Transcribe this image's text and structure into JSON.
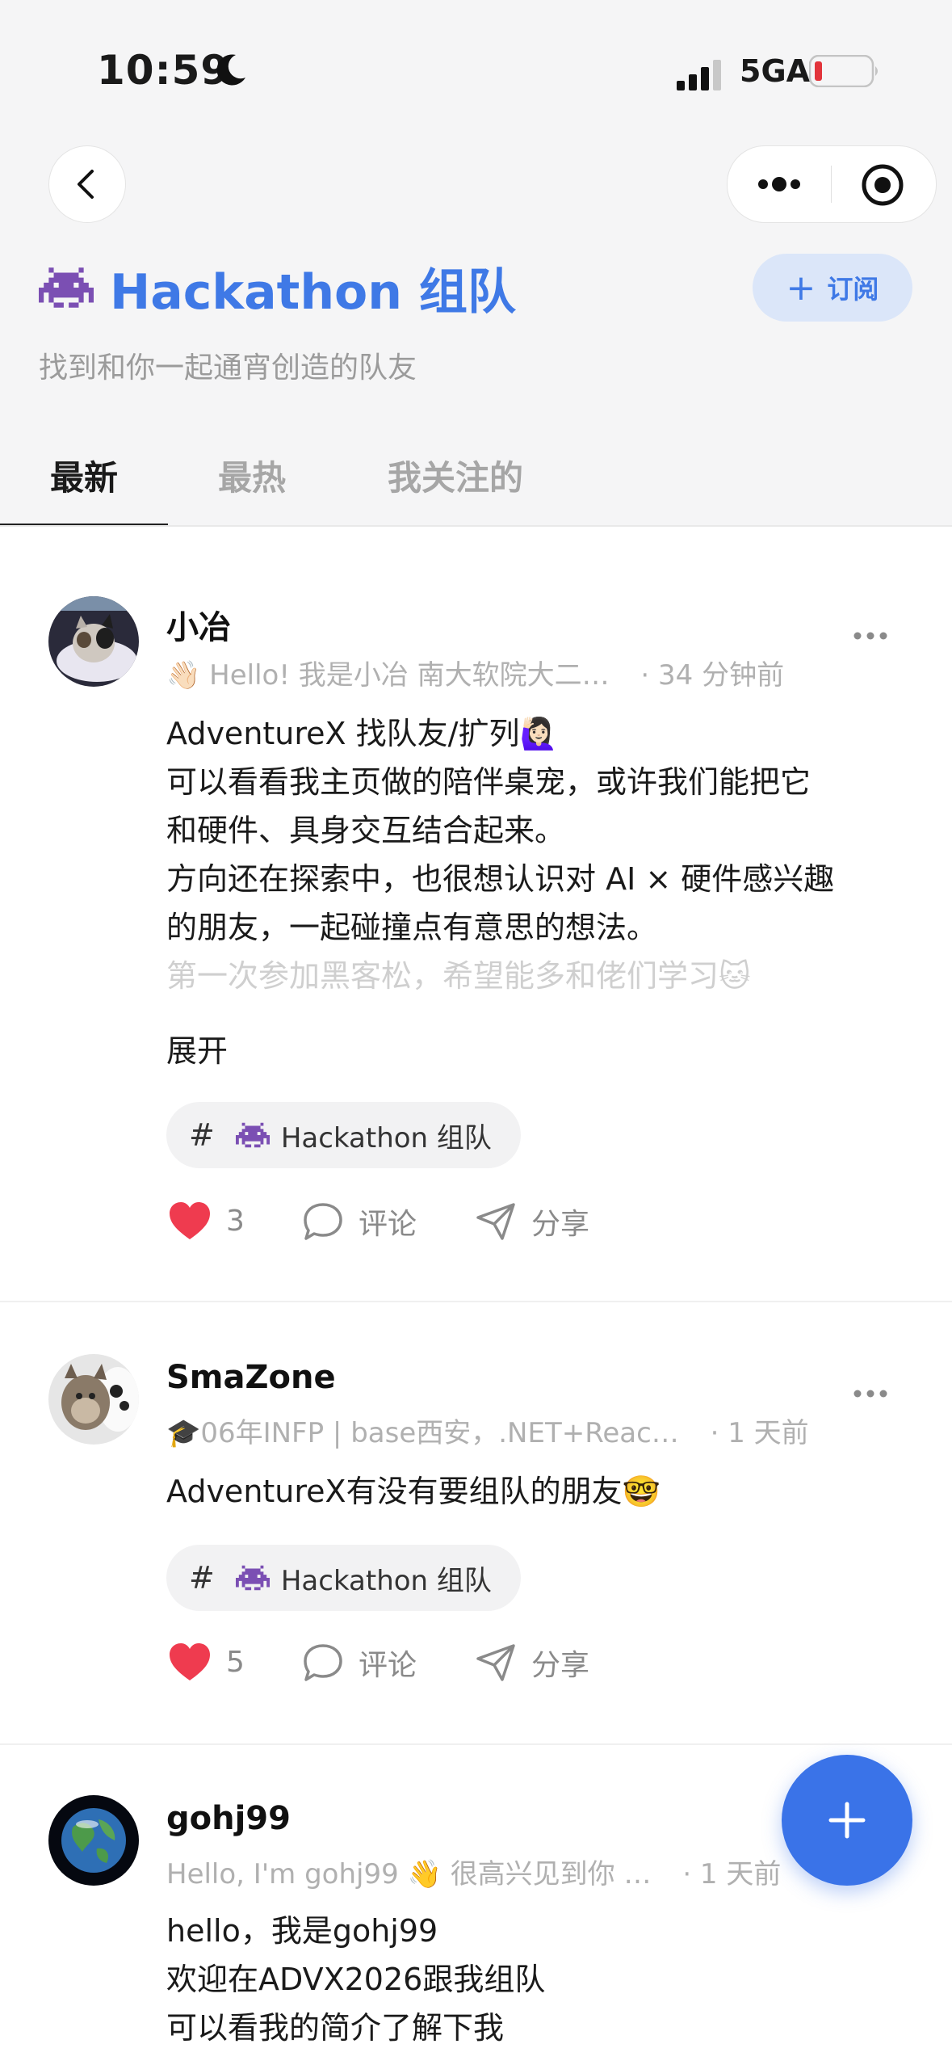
{
  "status_bar": {
    "time": "10:59",
    "network": "5GA"
  },
  "header": {
    "title": "Hackathon 组队",
    "subscribe_label": "订阅",
    "subtitle": "找到和你一起通宵创造的队友",
    "accent": "#3f79e6"
  },
  "tabs": [
    {
      "label": "最新",
      "active": true
    },
    {
      "label": "最热",
      "active": false
    },
    {
      "label": "我关注的",
      "active": false
    }
  ],
  "posts": [
    {
      "author": "小冶",
      "bio": "👋🏻 Hello! 我是小冶 南大软院大二…",
      "time": "· 34 分钟前",
      "lines": [
        "AdventureX 找队友/扩列🙋🏻‍♀️",
        "可以看看我主页做的陪伴桌宠，或许我们能把它",
        "和硬件、具身交互结合起来。",
        "方向还在探索中，也很想认识对 AI × 硬件感兴趣",
        "的朋友，一起碰撞点有意思的想法。",
        "第一次参加黑客松，希望能多和佬们学习🐱"
      ],
      "expand_label": "展开",
      "tag": "Hackathon 组队",
      "likes": "3",
      "comment_label": "评论",
      "share_label": "分享"
    },
    {
      "author": "SmaZone",
      "bio": "🎓06年INFP | base西安，.NET+Reac…",
      "time": "· 1 天前",
      "lines": [
        "AdventureX有没有要组队的朋友🤓"
      ],
      "tag": "Hackathon 组队",
      "likes": "5",
      "comment_label": "评论",
      "share_label": "分享"
    },
    {
      "author": "gohj99",
      "bio": "Hello, I'm gohj99 👋 很高兴见到你 …",
      "time": "· 1 天前",
      "lines": [
        "hello，我是gohj99",
        "欢迎在ADVX2026跟我组队",
        "可以看我的简介了解下我"
      ]
    }
  ],
  "colors": {
    "like": "#ef3b4f",
    "fab": "#3a73e8"
  }
}
